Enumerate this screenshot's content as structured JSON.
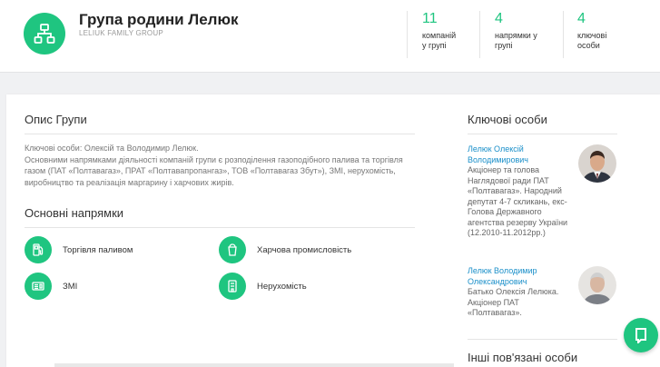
{
  "header": {
    "title": "Група родини Лелюк",
    "subtitle": "LELIUK FAMILY GROUP",
    "stats": [
      {
        "value": "11",
        "label_line1": "компаній",
        "label_line2": "у групі"
      },
      {
        "value": "4",
        "label_line1": "напрямки у",
        "label_line2": "групі"
      },
      {
        "value": "4",
        "label_line1": "ключові",
        "label_line2": "особи"
      }
    ]
  },
  "description": {
    "title": "Опис Групи",
    "text": "Ключові особи: Олексій та Володимир Лелюк.\nОсновними напрямками діяльності компаній групи є розподілення газоподібного палива та торгівля газом (ПАТ «Полтавагаз», ПРАТ «Полтавапропангаз», ТОВ «Полтавагаз Збут»), ЗМІ, нерухомість, виробництво та реалізація маргарину і харчових жирів."
  },
  "directions": {
    "title": "Основні напрямки",
    "items": [
      {
        "label": "Торгівля паливом",
        "icon": "fuel-icon"
      },
      {
        "label": "Харчова промисловість",
        "icon": "food-icon"
      },
      {
        "label": "ЗМІ",
        "icon": "media-icon"
      },
      {
        "label": "Нерухомість",
        "icon": "real-estate-icon"
      }
    ]
  },
  "key_persons": {
    "title": "Ключові особи",
    "people": [
      {
        "name": "Лелюк Олексій Володимирович",
        "text": "Акціонер та голова Наглядової ради ПАТ «Полтавагаз». Народний депутат 4-7 скликань, екс-Голова Державного агентства резерву України (12.2010-11.2012рр.)"
      },
      {
        "name": "Лелюк Володимир Олександрович",
        "text": "Батько Олексія Лелюка. Акціонер ПАТ «Полтавагаз»."
      }
    ]
  },
  "other_persons": {
    "title": "Інші пов'язані особи"
  },
  "colors": {
    "accent": "#1fc580",
    "link": "#1a8fc9"
  }
}
